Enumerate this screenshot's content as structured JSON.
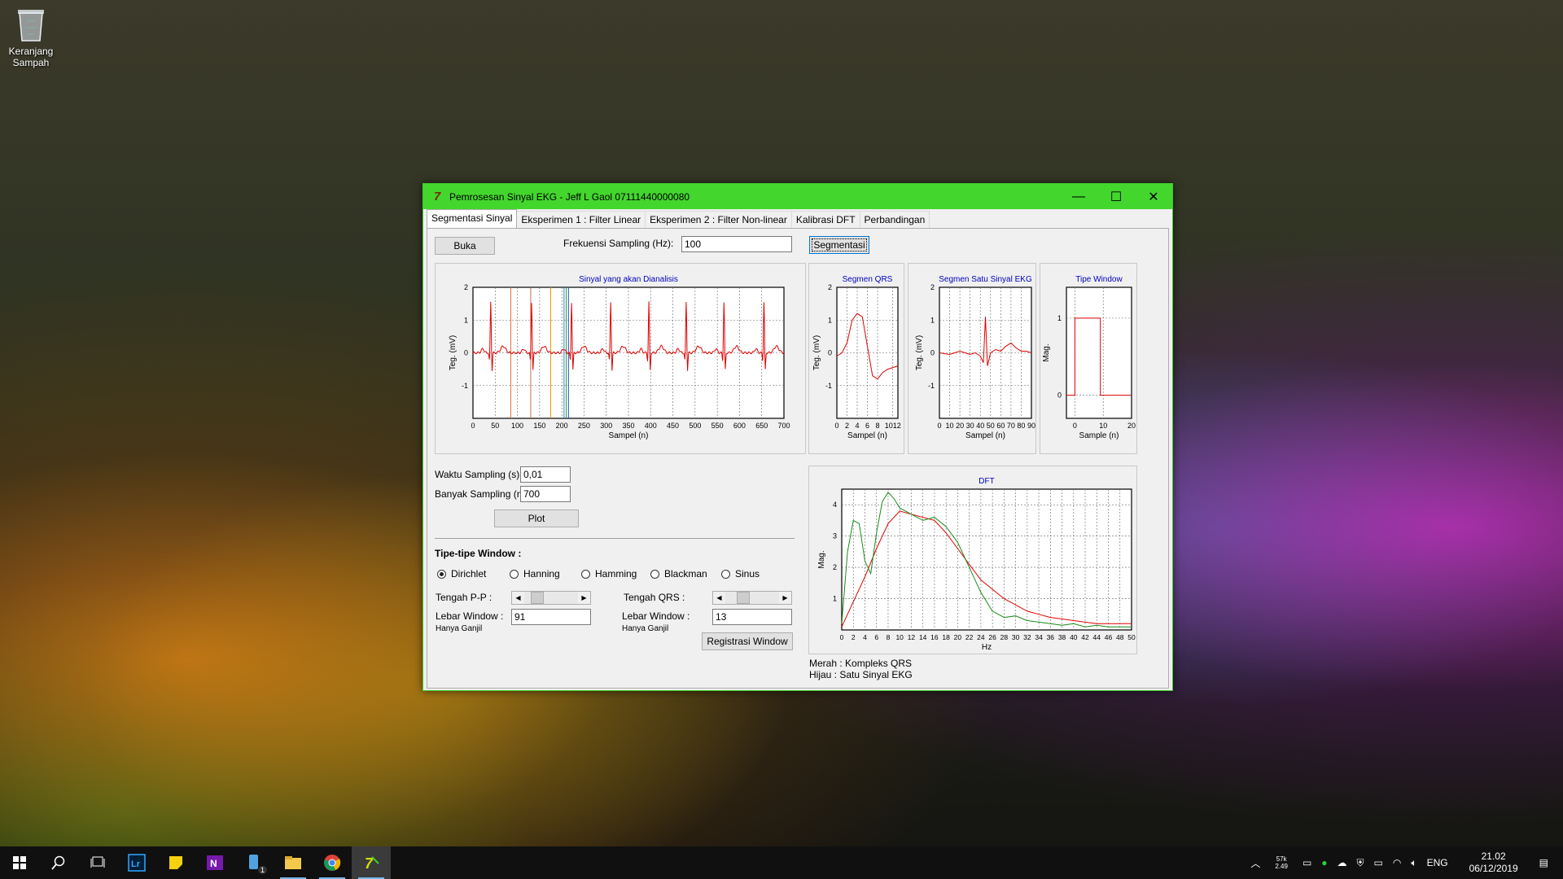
{
  "desktop": {
    "recycle_bin_label_1": "Keranjang",
    "recycle_bin_label_2": "Sampah"
  },
  "window": {
    "title": "Pemrosesan Sinyal EKG - Jeff L Gaol 07111440000080",
    "minimize": "—",
    "maximize": "☐",
    "close": "✕",
    "tabs": [
      "Segmentasi Sinyal",
      "Eksperimen 1 : Filter Linear",
      "Eksperimen 2 : Filter Non-linear",
      "Kalibrasi DFT",
      "Perbandingan"
    ]
  },
  "controls": {
    "open_button": "Buka",
    "freq_label": "Frekuensi Sampling (Hz):",
    "freq_value": "100",
    "segment_button": "Segmentasi",
    "ts_label": "Waktu Sampling (s) :",
    "ts_value": "0,01",
    "n_label": "Banyak Sampling (n) :",
    "n_value": "700",
    "plot_button": "Plot",
    "window_types_heading": "Tipe-tipe Window :",
    "window_types": [
      "Dirichlet",
      "Hanning",
      "Hamming",
      "Blackman",
      "Sinus"
    ],
    "selected_window": "Dirichlet",
    "pp_center_label": "Tengah P-P :",
    "qrs_center_label": "Tengah QRS :",
    "window_width_label": "Lebar Window :",
    "odd_only_note": "Hanya Ganjil",
    "pp_width_value": "91",
    "qrs_width_value": "13",
    "pp_slider_level": 0.15,
    "qrs_slider_level": 0.27,
    "register_button": "Registrasi Window",
    "legend_red": "Merah : Kompleks QRS",
    "legend_green": "Hijau : Satu Sinyal EKG"
  },
  "charts": {
    "main": {
      "title": "Sinyal yang akan Dianalisis",
      "ylabel": "Teg. (mV)",
      "xlabel": "Sampel (n)",
      "xticks": [
        "0",
        "50",
        "100",
        "150",
        "200",
        "250",
        "300",
        "350",
        "400",
        "450",
        "500",
        "550",
        "600",
        "650",
        "700"
      ],
      "yticks": [
        "2",
        "1",
        "0",
        "-1"
      ]
    },
    "qrs": {
      "title": "Segmen QRS",
      "ylabel": "Teg. (mV)",
      "xlabel": "Sampel (n)",
      "xticks": [
        "0",
        "2",
        "4",
        "6",
        "8",
        "1012"
      ],
      "yticks": [
        "2",
        "1",
        "0",
        "-1"
      ]
    },
    "one_beat": {
      "title": "Segmen Satu Sinyal EKG",
      "ylabel": "Teg. (mV)",
      "xlabel": "Sampel (n)",
      "xticks": [
        "0",
        "10",
        "20",
        "30",
        "40",
        "50",
        "60",
        "70",
        "80",
        "90"
      ],
      "yticks": [
        "2",
        "1",
        "0",
        "-1"
      ]
    },
    "window_type": {
      "title": "Tipe Window",
      "ylabel": "Mag.",
      "xlabel": "Sample (n)",
      "xticks": [
        "0",
        "10",
        "20"
      ],
      "yticks": [
        "1",
        "0"
      ]
    },
    "dft": {
      "title": "DFT",
      "ylabel": "Mag.",
      "xlabel": "Hz",
      "xticks": [
        "0",
        "2",
        "4",
        "6",
        "8",
        "10",
        "12",
        "14",
        "16",
        "18",
        "20",
        "22",
        "24",
        "26",
        "28",
        "30",
        "32",
        "34",
        "36",
        "38",
        "40",
        "42",
        "44",
        "46",
        "48",
        "50"
      ],
      "yticks": [
        "4",
        "3",
        "2",
        "1"
      ]
    }
  },
  "chart_data": [
    {
      "type": "line",
      "title": "Sinyal yang akan Dianalisis",
      "xlabel": "Sampel (n)",
      "ylabel": "Teg. (mV)",
      "xlim": [
        0,
        700
      ],
      "ylim": [
        -2,
        2
      ],
      "series": [
        {
          "color": "#e00000",
          "beat_peaks_x": [
            40,
            132,
            222,
            310,
            396,
            480,
            565,
            655
          ]
        }
      ],
      "markers_x": [
        {
          "x": 85,
          "color": "#e07020"
        },
        {
          "x": 130,
          "color": "#c07050"
        },
        {
          "x": 175,
          "color": "#e0a000"
        },
        {
          "x": 205,
          "color": "#3080e0"
        },
        {
          "x": 210,
          "color": "#20a020"
        },
        {
          "x": 215,
          "color": "#2050d0"
        }
      ]
    },
    {
      "type": "line",
      "title": "Segmen QRS",
      "xlabel": "Sampel (n)",
      "ylabel": "Teg. (mV)",
      "xlim": [
        0,
        12
      ],
      "ylim": [
        -2,
        2
      ],
      "series": [
        {
          "color": "#e00000",
          "x": [
            0,
            1,
            2,
            3,
            4,
            5,
            6,
            7,
            8,
            9,
            10,
            11,
            12
          ],
          "y": [
            -0.1,
            0.0,
            0.3,
            1.0,
            1.2,
            1.1,
            0.2,
            -0.7,
            -0.8,
            -0.6,
            -0.5,
            -0.45,
            -0.4
          ]
        }
      ]
    },
    {
      "type": "line",
      "title": "Segmen Satu Sinyal EKG",
      "xlabel": "Sampel (n)",
      "ylabel": "Teg. (mV)",
      "xlim": [
        0,
        90
      ],
      "ylim": [
        -2,
        2
      ],
      "series": [
        {
          "color": "#e00000",
          "x": [
            0,
            10,
            20,
            25,
            30,
            35,
            40,
            43,
            45,
            47,
            50,
            55,
            60,
            65,
            70,
            75,
            80,
            85,
            90
          ],
          "y": [
            0.0,
            -0.05,
            0.05,
            0.0,
            -0.05,
            0.0,
            -0.1,
            -0.3,
            1.1,
            -0.4,
            0.0,
            0.1,
            0.05,
            0.2,
            0.3,
            0.15,
            0.05,
            0.05,
            0.0
          ]
        }
      ]
    },
    {
      "type": "line",
      "title": "Tipe Window",
      "xlabel": "Sample (n)",
      "ylabel": "Mag.",
      "xlim": [
        -3,
        20
      ],
      "ylim": [
        -0.3,
        1.4
      ],
      "series": [
        {
          "color": "#e00000",
          "x": [
            -3,
            0,
            0,
            9,
            9,
            20
          ],
          "y": [
            0,
            0,
            1,
            1,
            0,
            0
          ]
        }
      ]
    },
    {
      "type": "line",
      "title": "DFT",
      "xlabel": "Hz",
      "ylabel": "Mag.",
      "xlim": [
        0,
        50
      ],
      "ylim": [
        0,
        4.5
      ],
      "series": [
        {
          "name": "Kompleks QRS",
          "color": "#e00000",
          "x": [
            0,
            2,
            4,
            6,
            8,
            10,
            12,
            14,
            16,
            18,
            20,
            22,
            24,
            26,
            28,
            30,
            32,
            34,
            36,
            38,
            40,
            42,
            44,
            46,
            48,
            50
          ],
          "y": [
            0.1,
            0.9,
            1.7,
            2.6,
            3.4,
            3.8,
            3.7,
            3.6,
            3.5,
            3.1,
            2.6,
            2.1,
            1.6,
            1.3,
            1.0,
            0.8,
            0.6,
            0.5,
            0.4,
            0.35,
            0.3,
            0.25,
            0.2,
            0.2,
            0.2,
            0.2
          ]
        },
        {
          "name": "Satu Sinyal EKG",
          "color": "#1a8a1a",
          "x": [
            0,
            1,
            2,
            3,
            4,
            5,
            6,
            7,
            8,
            9,
            10,
            12,
            14,
            16,
            18,
            20,
            22,
            24,
            26,
            28,
            30,
            32,
            34,
            36,
            38,
            40,
            42,
            44,
            46,
            48,
            50
          ],
          "y": [
            0.2,
            2.5,
            3.5,
            3.4,
            2.2,
            1.8,
            3.1,
            4.1,
            4.4,
            4.2,
            3.9,
            3.7,
            3.5,
            3.6,
            3.3,
            2.8,
            2.0,
            1.2,
            0.6,
            0.4,
            0.45,
            0.3,
            0.25,
            0.2,
            0.15,
            0.2,
            0.1,
            0.15,
            0.1,
            0.1,
            0.1
          ]
        }
      ]
    }
  ],
  "taskbar": {
    "items": [
      "start-icon",
      "search-icon",
      "task-view-icon",
      "lightroom-icon",
      "sticky-notes-icon",
      "onenote-icon",
      "phone-icon",
      "file-explorer-icon",
      "chrome-icon",
      "app-icon"
    ],
    "phone_badge": "1",
    "lang": "ENG",
    "time": "21.02",
    "date": "06/12/2019",
    "net_up": "57k",
    "net_down": "2.49"
  },
  "colors": {
    "titlebar": "#43d62d",
    "signal": "#e00000",
    "green_series": "#1a8a1a",
    "chart_title": "#0000c0"
  }
}
